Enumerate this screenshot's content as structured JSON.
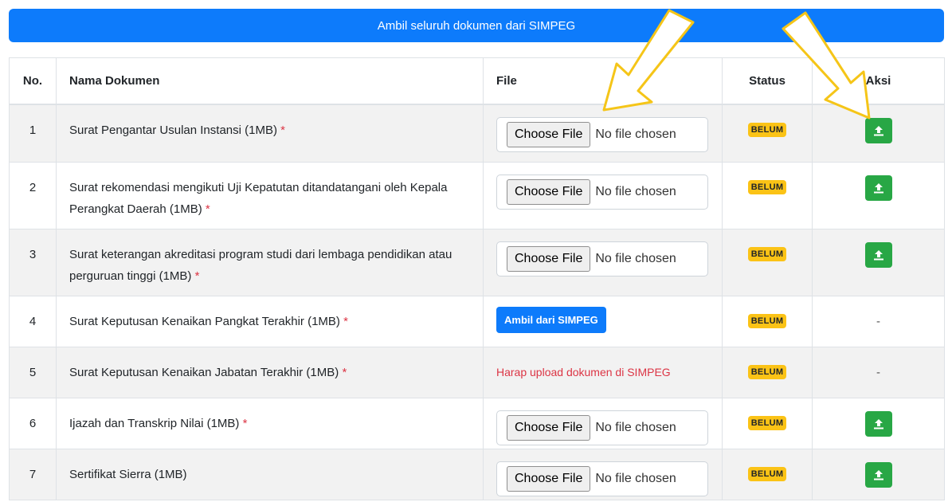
{
  "top_button": {
    "label": "Ambil seluruh dokumen dari SIMPEG"
  },
  "table": {
    "headers": {
      "no": "No.",
      "name": "Nama Dokumen",
      "file": "File",
      "status": "Status",
      "action": "Aksi"
    },
    "rows": [
      {
        "no": "1",
        "name": "Surat Pengantar Usulan Instansi (1MB)",
        "required": "*",
        "file_type": "input",
        "status": "BELUM",
        "action": "upload"
      },
      {
        "no": "2",
        "name": "Surat rekomendasi mengikuti Uji Kepatutan ditandatangani oleh Kepala Perangkat Daerah (1MB)",
        "required": "*",
        "file_type": "input",
        "status": "BELUM",
        "action": "upload"
      },
      {
        "no": "3",
        "name": "Surat keterangan akreditasi program studi dari lembaga pendidikan atau perguruan tinggi (1MB)",
        "required": "*",
        "file_type": "input",
        "status": "BELUM",
        "action": "upload"
      },
      {
        "no": "4",
        "name": "Surat Keputusan Kenaikan Pangkat Terakhir (1MB)",
        "required": "*",
        "file_type": "simpeg",
        "status": "BELUM",
        "action": "-"
      },
      {
        "no": "5",
        "name": "Surat Keputusan Kenaikan Jabatan Terakhir (1MB)",
        "required": "*",
        "file_type": "warning",
        "status": "BELUM",
        "action": "-"
      },
      {
        "no": "6",
        "name": "Ijazah dan Transkrip Nilai (1MB)",
        "required": "*",
        "file_type": "input",
        "status": "BELUM",
        "action": "upload"
      },
      {
        "no": "7",
        "name": "Sertifikat Sierra (1MB)",
        "required": "",
        "file_type": "input",
        "status": "BELUM",
        "action": "upload"
      }
    ]
  },
  "file_input": {
    "button_label": "Choose File",
    "empty_text": "No file chosen"
  },
  "simpeg_button": {
    "label": "Ambil dari SIMPEG"
  },
  "simpeg_warning": "Harap upload dokumen di SIMPEG",
  "dash_text": "-",
  "icons": {
    "upload": "upload-icon",
    "arrow": "pointer-arrow"
  },
  "colors": {
    "primary": "#0d7bfb",
    "success": "#28a745",
    "warning": "#fbc316",
    "danger": "#dc3545",
    "arrow": "#f5c518"
  }
}
